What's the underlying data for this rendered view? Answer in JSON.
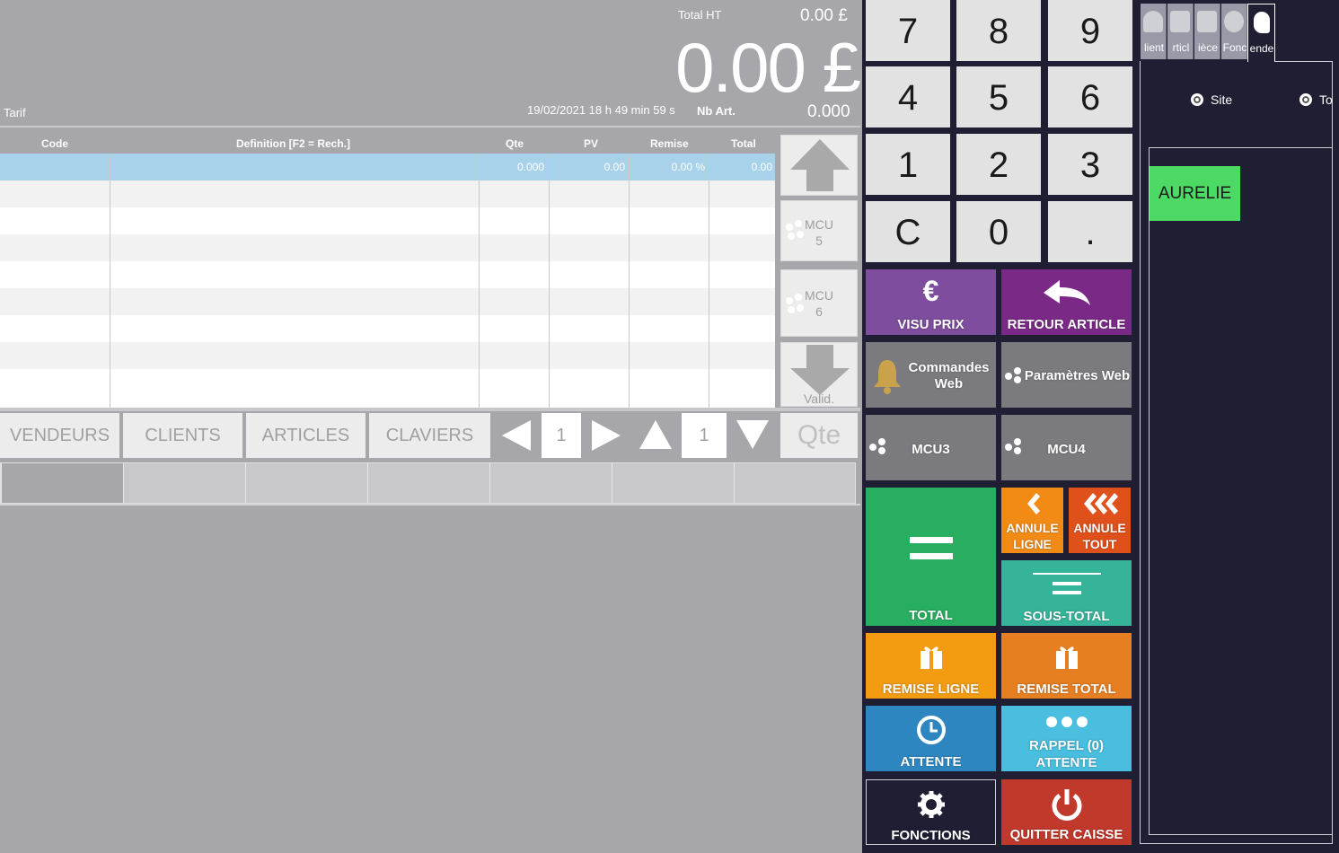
{
  "header": {
    "total_ht_label": "Total HT",
    "total_ht_value": "0.00 £",
    "total_big": "0.00 £",
    "tarif_label": "Tarif",
    "datetime": "19/02/2021  18 h 49 min 59 s",
    "nb_art_label": "Nb Art.",
    "nb_art_value": "0.000"
  },
  "grid": {
    "columns": [
      "Code",
      "Definition [F2 = Rech.]",
      "Qte",
      "PV",
      "Remise",
      "Total"
    ],
    "selected_row": {
      "qte": "0.000",
      "pv": "0.00",
      "remise": "0.00 %",
      "total": "0.00"
    }
  },
  "side_buttons": {
    "mcu5_line1": "MCU",
    "mcu5_line2": "5",
    "mcu6_line1": "MCU",
    "mcu6_line2": "6",
    "valid_label": "Valid."
  },
  "tabs": {
    "vendeurs": "VENDEURS",
    "clients": "CLIENTS",
    "articles": "ARTICLES",
    "claviers": "CLAVIERS",
    "page_h": "1",
    "page_v": "1",
    "qte": "Qte"
  },
  "keypad": [
    "7",
    "8",
    "9",
    "4",
    "5",
    "6",
    "1",
    "2",
    "3",
    "C",
    "0",
    "."
  ],
  "functions": {
    "visu_prix": "VISU PRIX",
    "retour_article": "RETOUR ARTICLE",
    "commandes_web": "Commandes Web",
    "parametres_web": "Paramètres Web",
    "mcu3": "MCU3",
    "mcu4": "MCU4",
    "total": "TOTAL",
    "annule_ligne": "ANNULE LIGNE",
    "annule_tout": "ANNULE TOUT",
    "sous_total": "SOUS-TOTAL",
    "remise_ligne": "REMISE LIGNE",
    "remise_total": "REMISE TOTAL",
    "attente": "ATTENTE",
    "rappel_attente": "RAPPEL (0) ATTENTE",
    "fonctions": "FONCTIONS",
    "quitter_caisse": "QUITTER CAISSE"
  },
  "right_panel": {
    "tabs": [
      "lient",
      "rticl",
      "ièce",
      "Fonc",
      "ende"
    ],
    "radio_site": "Site",
    "radio_tous": "To",
    "vendor": "AURELIE"
  },
  "colors": {
    "background": "#a7a6ab",
    "panel_dark": "#1f1e33",
    "selected_row": "#a8d2ea",
    "purple": "#7e4d9e",
    "dark_purple": "#7a2a86",
    "gray": "#7b7a7e",
    "green": "#27ae60",
    "orange": "#f28b16",
    "red_orange": "#e0501b",
    "teal": "#36b49a",
    "yellow_orange": "#f39c12",
    "dark_orange": "#e67e22",
    "blue": "#2e86c1",
    "light_blue": "#49bedf",
    "navy": "#1f1e33",
    "red": "#c0392b",
    "vendor_green": "#4cd964"
  }
}
